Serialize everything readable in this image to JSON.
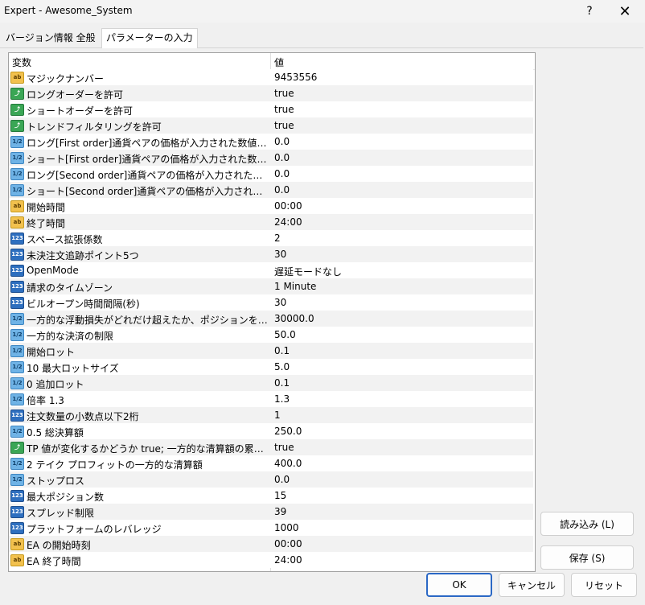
{
  "window": {
    "title": "Expert - Awesome_System",
    "help_label": "?",
    "close_label": "✕"
  },
  "tabs": [
    "バージョン情報 全般",
    "パラメーターの入力"
  ],
  "grid": {
    "headers": {
      "name": "変数",
      "value": "値"
    },
    "rows": [
      {
        "icon": "ab",
        "name": "マジックナンバー",
        "value": "9453556"
      },
      {
        "icon": "bool",
        "name": "ロングオーダーを許可",
        "value": "true"
      },
      {
        "icon": "bool",
        "name": "ショートオーダーを許可",
        "value": "true"
      },
      {
        "icon": "bool",
        "name": "トレンドフィルタリングを許可",
        "value": "true"
      },
      {
        "icon": "dbl",
        "name": "ロング[First order]通貨ペアの価格が入力された数値以上の…",
        "value": "0.0"
      },
      {
        "icon": "dbl",
        "name": "ショート[First order]通貨ペアの価格が入力された数値以上の…",
        "value": "0.0"
      },
      {
        "icon": "dbl",
        "name": "ロング[Second order]通貨ペアの価格が入力された数値以上…",
        "value": "0.0"
      },
      {
        "icon": "dbl",
        "name": "ショート[Second order]通貨ペアの価格が入力された数値以…",
        "value": "0.0"
      },
      {
        "icon": "ab",
        "name": "開始時間",
        "value": "00:00"
      },
      {
        "icon": "ab",
        "name": "終了時間",
        "value": "24:00"
      },
      {
        "icon": "int",
        "name": "スペース拡張係数",
        "value": "2"
      },
      {
        "icon": "int",
        "name": "未決注文追跡ポイント5つ",
        "value": "30"
      },
      {
        "icon": "int",
        "name": "OpenMode",
        "value": "遅延モードなし"
      },
      {
        "icon": "int",
        "name": "請求のタイムゾーン",
        "value": "1 Minute"
      },
      {
        "icon": "int",
        "name": "ビルオープン時間間隔(秒)",
        "value": "30"
      },
      {
        "icon": "dbl",
        "name": "一方的な浮動損失がどれだけ超えたか、ポジションを増やし続…",
        "value": "30000.0"
      },
      {
        "icon": "dbl",
        "name": "一方的な決済の制限",
        "value": "50.0"
      },
      {
        "icon": "dbl",
        "name": "開始ロット",
        "value": "0.1"
      },
      {
        "icon": "dbl",
        "name": "10 最大ロットサイズ",
        "value": "5.0"
      },
      {
        "icon": "dbl",
        "name": "0 追加ロット",
        "value": "0.1"
      },
      {
        "icon": "dbl",
        "name": "倍率 1.3",
        "value": "1.3"
      },
      {
        "icon": "int",
        "name": "注文数量の小数点以下2桁",
        "value": "1"
      },
      {
        "icon": "dbl",
        "name": "0.5 総決算額",
        "value": "250.0"
      },
      {
        "icon": "bool",
        "name": "TP 値が変化するかどうか true; 一方的な清算額の累積スイッチ",
        "value": "true"
      },
      {
        "icon": "dbl",
        "name": "2 テイク プロフィットの一方的な清算額",
        "value": "400.0"
      },
      {
        "icon": "dbl",
        "name": "ストップロス",
        "value": "0.0"
      },
      {
        "icon": "int",
        "name": "最大ポジション数",
        "value": "15"
      },
      {
        "icon": "int",
        "name": "スプレッド制限",
        "value": "39"
      },
      {
        "icon": "int",
        "name": "プラットフォームのレバレッジ",
        "value": "1000"
      },
      {
        "icon": "ab",
        "name": "EA の開始時刻",
        "value": "00:00"
      },
      {
        "icon": "ab",
        "name": "EA 終了時間",
        "value": "24:00"
      }
    ]
  },
  "icon_labels": {
    "ab": "ab",
    "bool": "⤴",
    "dbl": "1/2",
    "int": "123"
  },
  "buttons": {
    "load": "読み込み (L)",
    "save": "保存 (S)",
    "ok": "OK",
    "cancel": "キャンセル",
    "reset": "リセット"
  }
}
